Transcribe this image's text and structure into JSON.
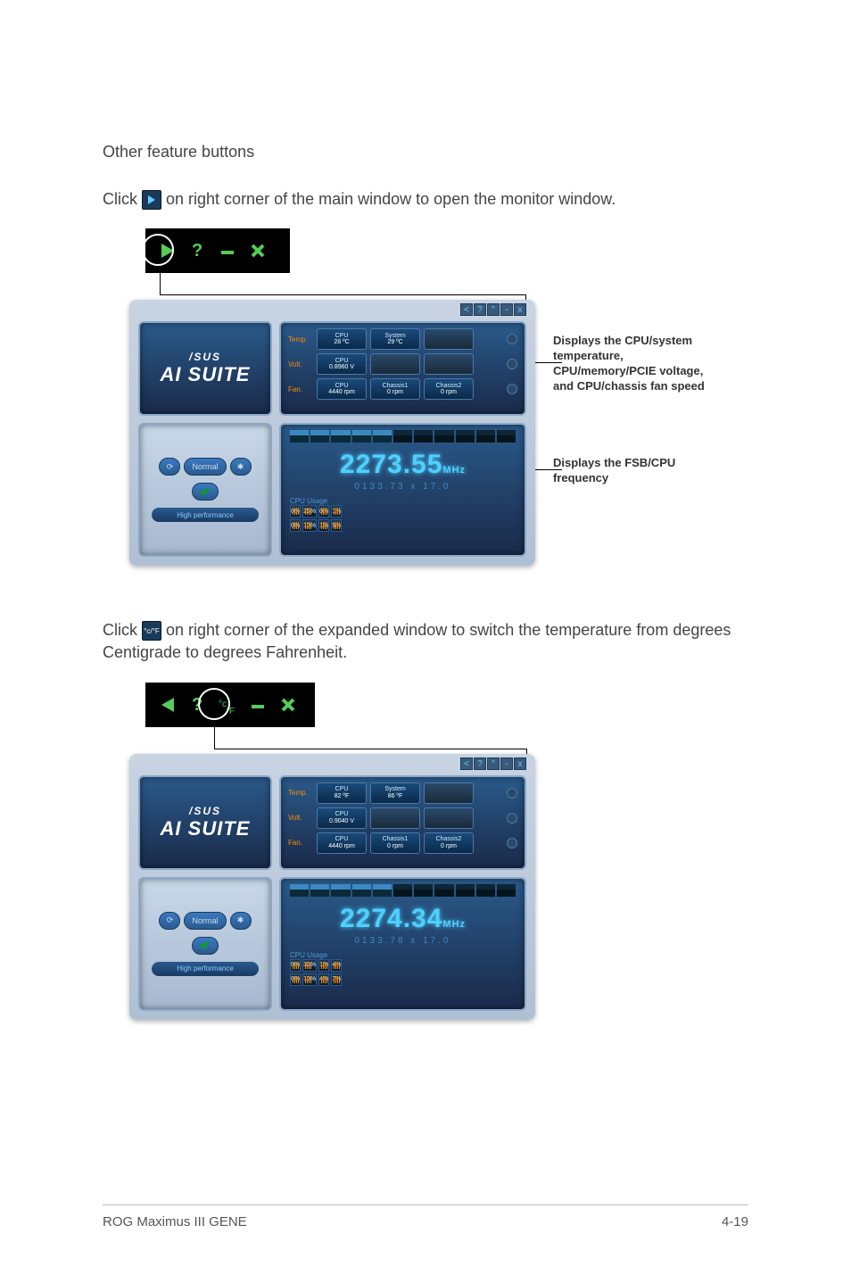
{
  "heading": "Other feature buttons",
  "para1_a": "Click ",
  "para1_b": " on right corner of the main window to open the monitor window.",
  "para2_a": "Click ",
  "para2_b": " on right corner of the expanded window to switch the temperature from degrees Centigrade to degrees Fahrenheit.",
  "callout_temp": "Displays the CPU/system temperature, CPU/memory/PCIE voltage, and CPU/chassis fan speed",
  "callout_freq": "Displays the FSB/CPU frequency",
  "logo_brand": "/SUS",
  "logo_product": "AI SUITE",
  "ctrl_normal": "Normal",
  "ctrl_perf": "High performance",
  "win1": {
    "sens": {
      "temp_label": "Temp.",
      "volt_label": "Volt.",
      "fan_label": "Fan.",
      "cpu_temp": {
        "t": "CPU",
        "v": "28 ºC"
      },
      "sys_temp": {
        "t": "System",
        "v": "29 ºC"
      },
      "cpu_volt": {
        "t": "CPU",
        "v": "0.8960 V"
      },
      "cpu_fan": {
        "t": "CPU",
        "v": "4440 rpm"
      },
      "ch1_fan": {
        "t": "Chassis1",
        "v": "0 rpm"
      },
      "ch2_fan": {
        "t": "Chassis2",
        "v": "0 rpm"
      }
    },
    "freq_main": "2273.55",
    "freq_unit": "MHz",
    "freq_sub": "0133.73  x  17.0",
    "cpu_usage_label": "CPU Usage",
    "usage": [
      [
        "0%",
        "26%",
        "0%",
        "1%"
      ],
      [
        "0%",
        "10%",
        "1%",
        "5%"
      ]
    ]
  },
  "win2": {
    "sens": {
      "temp_label": "Temp.",
      "volt_label": "Volt.",
      "fan_label": "Fan.",
      "cpu_temp": {
        "t": "CPU",
        "v": "82 ºF"
      },
      "sys_temp": {
        "t": "System",
        "v": "86 ºF"
      },
      "cpu_volt": {
        "t": "CPU",
        "v": "0.9040 V"
      },
      "cpu_fan": {
        "t": "CPU",
        "v": "4440 rpm"
      },
      "ch1_fan": {
        "t": "Chassis1",
        "v": "0 rpm"
      },
      "ch2_fan": {
        "t": "Chassis2",
        "v": "0 rpm"
      }
    },
    "freq_main": "2274.34",
    "freq_unit": "MHz",
    "freq_sub": "0133.78  x  17.0",
    "cpu_usage_label": "CPU Usage",
    "usage": [
      [
        "0%",
        "33%",
        "1%",
        "4%"
      ],
      [
        "0%",
        "10%",
        "4%",
        "7%"
      ]
    ]
  },
  "footer_left": "ROG Maximus III GENE",
  "footer_right": "4-19"
}
